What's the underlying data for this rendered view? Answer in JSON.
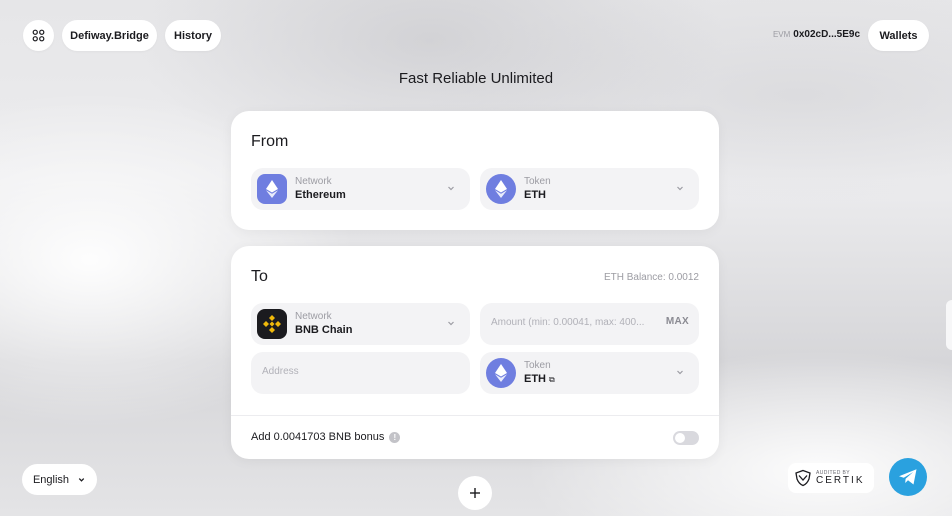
{
  "header": {
    "menu_icon": "grid-icon",
    "brand_label": "Defiway.Bridge",
    "history_label": "History",
    "evm_tag": "EVM",
    "wallet_address": "0x02cD...5E9c",
    "wallets_label": "Wallets"
  },
  "tagline": "Fast Reliable Unlimited",
  "from_card": {
    "title": "From",
    "network": {
      "label": "Network",
      "value": "Ethereum",
      "icon": "ethereum-icon"
    },
    "token": {
      "label": "Token",
      "value": "ETH",
      "icon": "eth-token-icon"
    }
  },
  "to_card": {
    "title": "To",
    "balance_text": "ETH Balance: 0.0012",
    "network": {
      "label": "Network",
      "value": "BNB Chain",
      "icon": "bnb-icon"
    },
    "amount_placeholder": "Amount (min: 0.00041, max: 400...",
    "max_label": "MAX",
    "address_placeholder": "Address",
    "token": {
      "label": "Token",
      "value": "ETH",
      "icon": "eth-token-icon"
    },
    "bonus_text": "Add 0.0041703 BNB bonus",
    "bonus_enabled": false
  },
  "footer": {
    "language": "English",
    "add_icon": "plus-icon",
    "certik_small": "AUDITED BY",
    "certik_big": "CERTIK",
    "telegram_icon": "telegram-icon"
  },
  "colors": {
    "eth_purple": "#6f7ee0",
    "bnb_yellow": "#f0b90b",
    "telegram_blue": "#2aa1df"
  }
}
